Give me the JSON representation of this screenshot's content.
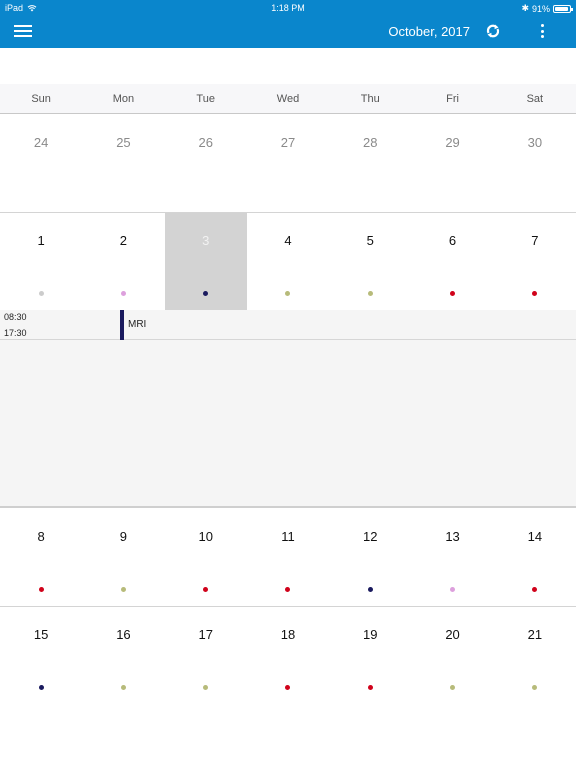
{
  "status_bar": {
    "device": "iPad",
    "time": "1:18 PM",
    "battery": "91%",
    "battery_level": 0.91
  },
  "app_bar": {
    "title": "October, 2017",
    "menu_icon": "hamburger-menu-icon",
    "refresh_icon": "refresh-icon",
    "more_icon": "more-vertical-icon",
    "background": "#0a86cc"
  },
  "weekdays": [
    "Sun",
    "Mon",
    "Tue",
    "Wed",
    "Thu",
    "Fri",
    "Sat"
  ],
  "dot_colors": {
    "gray": "#cccccc",
    "pink": "#dda0dd",
    "navy": "#1a1a5e",
    "olive": "#b7bb7a",
    "red": "#d0021b"
  },
  "weeks": [
    {
      "days": [
        {
          "num": "24",
          "other": true,
          "dot": null
        },
        {
          "num": "25",
          "other": true,
          "dot": null
        },
        {
          "num": "26",
          "other": true,
          "dot": null
        },
        {
          "num": "27",
          "other": true,
          "dot": null
        },
        {
          "num": "28",
          "other": true,
          "dot": null
        },
        {
          "num": "29",
          "other": true,
          "dot": null
        },
        {
          "num": "30",
          "other": true,
          "dot": null
        }
      ]
    },
    {
      "days": [
        {
          "num": "1",
          "dot": "gray"
        },
        {
          "num": "2",
          "dot": "pink"
        },
        {
          "num": "3",
          "dot": "navy",
          "selected": true
        },
        {
          "num": "4",
          "dot": "olive"
        },
        {
          "num": "5",
          "dot": "olive"
        },
        {
          "num": "6",
          "dot": "red"
        },
        {
          "num": "7",
          "dot": "red"
        }
      ]
    },
    {
      "days": [
        {
          "num": "8",
          "dot": "red"
        },
        {
          "num": "9",
          "dot": "olive"
        },
        {
          "num": "10",
          "dot": "red"
        },
        {
          "num": "11",
          "dot": "red"
        },
        {
          "num": "12",
          "dot": "navy"
        },
        {
          "num": "13",
          "dot": "pink"
        },
        {
          "num": "14",
          "dot": "red"
        }
      ]
    },
    {
      "days": [
        {
          "num": "15",
          "dot": "navy"
        },
        {
          "num": "16",
          "dot": "olive"
        },
        {
          "num": "17",
          "dot": "olive"
        },
        {
          "num": "18",
          "dot": "red"
        },
        {
          "num": "19",
          "dot": "red"
        },
        {
          "num": "20",
          "dot": "olive"
        },
        {
          "num": "21",
          "dot": "olive"
        }
      ]
    }
  ],
  "agenda": {
    "events": [
      {
        "start": "08:30",
        "end": "17:30",
        "title": "MRI",
        "color": "navy"
      }
    ]
  }
}
